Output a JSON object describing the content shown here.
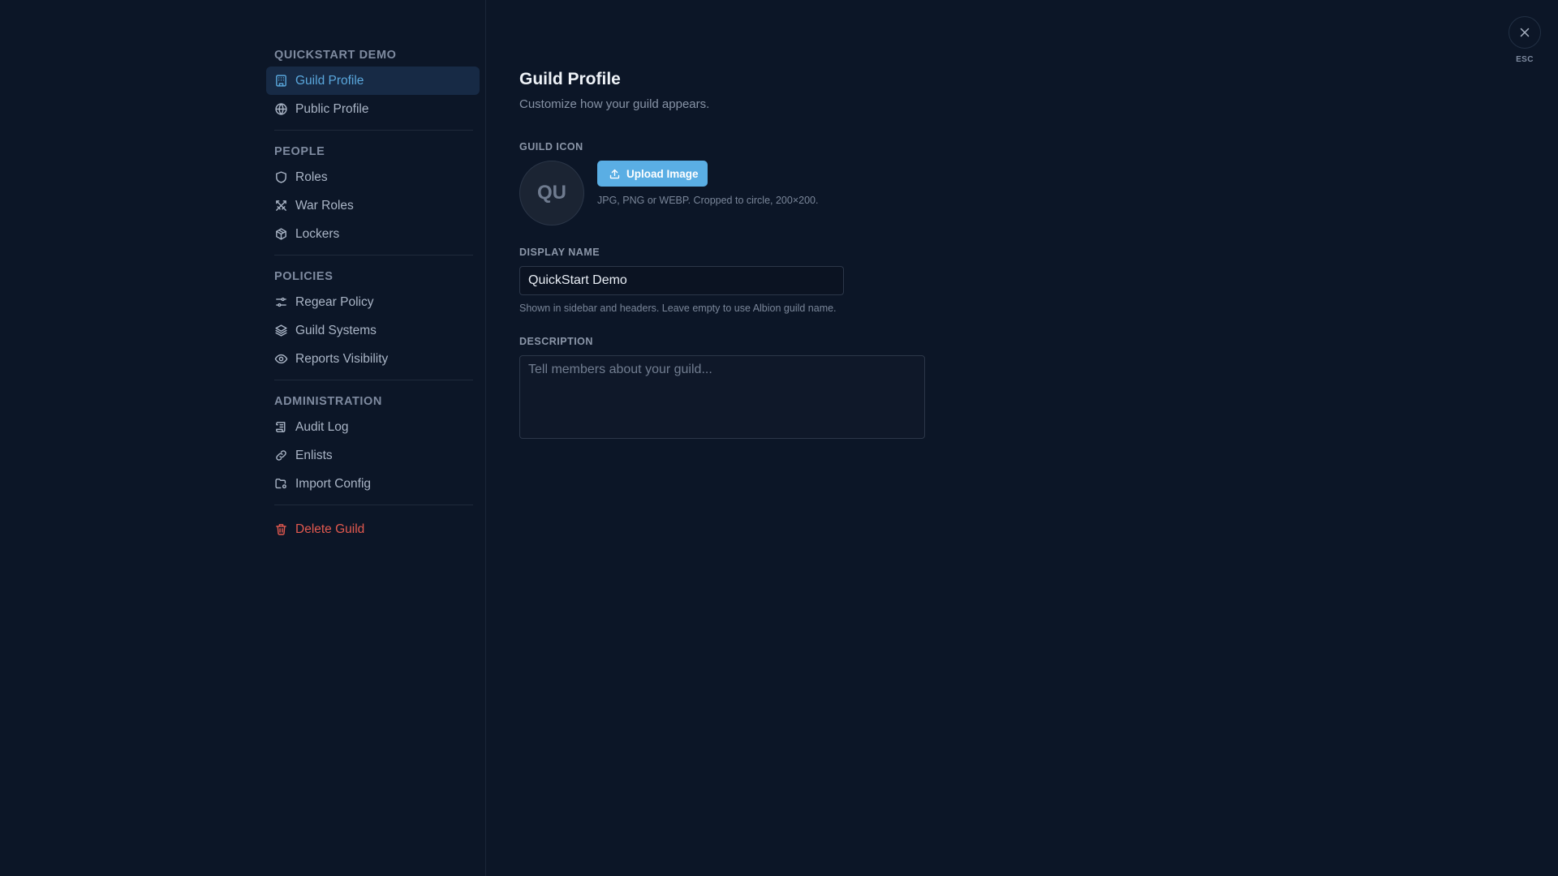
{
  "colors": {
    "background": "#0c1627",
    "accent": "#5aaee4",
    "active_item_bg": "#172a45",
    "danger": "#e2594f"
  },
  "sidebar": {
    "sections": [
      {
        "title": "QUICKSTART DEMO",
        "items": [
          {
            "label": "Guild Profile",
            "icon": "building-icon",
            "active": true
          },
          {
            "label": "Public Profile",
            "icon": "globe-icon"
          }
        ]
      },
      {
        "title": "PEOPLE",
        "items": [
          {
            "label": "Roles",
            "icon": "shield-icon"
          },
          {
            "label": "War Roles",
            "icon": "crossed-swords-icon"
          },
          {
            "label": "Lockers",
            "icon": "box-icon"
          }
        ]
      },
      {
        "title": "POLICIES",
        "items": [
          {
            "label": "Regear Policy",
            "icon": "sliders-icon"
          },
          {
            "label": "Guild Systems",
            "icon": "layers-icon"
          },
          {
            "label": "Reports Visibility",
            "icon": "eye-icon"
          }
        ]
      },
      {
        "title": "ADMINISTRATION",
        "items": [
          {
            "label": "Audit Log",
            "icon": "scroll-icon"
          },
          {
            "label": "Enlists",
            "icon": "link-icon"
          },
          {
            "label": "Import Config",
            "icon": "folder-cog-icon"
          }
        ]
      }
    ],
    "danger_item": {
      "label": "Delete Guild",
      "icon": "trash-icon"
    }
  },
  "main": {
    "title": "Guild Profile",
    "subtitle": "Customize how your guild appears.",
    "guild_icon": {
      "label": "GUILD ICON",
      "avatar_text": "QU",
      "upload_label": "Upload Image",
      "hint": "JPG, PNG or WEBP. Cropped to circle, 200×200."
    },
    "display_name": {
      "label": "DISPLAY NAME",
      "value": "QuickStart Demo",
      "hint": "Shown in sidebar and headers. Leave empty to use Albion guild name."
    },
    "description": {
      "label": "DESCRIPTION",
      "value": "",
      "placeholder": "Tell members about your guild..."
    }
  },
  "close": {
    "esc_label": "ESC",
    "icon": "close-icon"
  }
}
